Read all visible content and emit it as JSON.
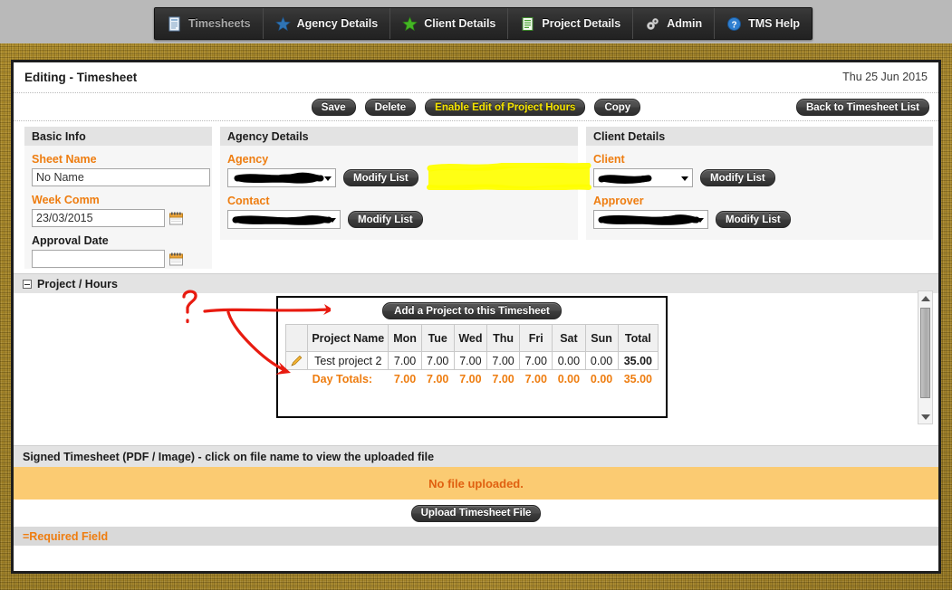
{
  "nav": {
    "items": [
      {
        "label": "Timesheets",
        "icon": "timesheet-document-icon",
        "current": true
      },
      {
        "label": "Agency Details",
        "icon": "blue-star-icon",
        "current": false
      },
      {
        "label": "Client Details",
        "icon": "green-star-icon",
        "current": false
      },
      {
        "label": "Project Details",
        "icon": "green-document-icon",
        "current": false
      },
      {
        "label": "Admin",
        "icon": "gears-icon",
        "current": false
      },
      {
        "label": "TMS Help",
        "icon": "question-circle-icon",
        "current": false
      }
    ]
  },
  "header": {
    "title": "Editing - Timesheet",
    "date": "Thu 25 Jun 2015"
  },
  "toolbar": {
    "save_label": "Save",
    "delete_label": "Delete",
    "enable_edit_label": "Enable Edit of Project Hours",
    "copy_label": "Copy",
    "back_label": "Back to Timesheet List"
  },
  "basic_info": {
    "panel_title": "Basic Info",
    "sheet_name_label": "Sheet Name",
    "sheet_name_value": "No Name",
    "week_comm_label": "Week Comm",
    "week_comm_value": "23/03/2015",
    "approval_date_label": "Approval Date",
    "approval_date_value": ""
  },
  "agency_details": {
    "panel_title": "Agency Details",
    "agency_label": "Agency",
    "agency_value": "",
    "agency_modify_label": "Modify List",
    "contact_label": "Contact",
    "contact_value": "",
    "contact_modify_label": "Modify List"
  },
  "client_details": {
    "panel_title": "Client Details",
    "client_label": "Client",
    "client_value": "",
    "client_modify_label": "Modify List",
    "approver_label": "Approver",
    "approver_value": "",
    "approver_modify_label": "Modify List"
  },
  "project_hours": {
    "section_title": "Project / Hours",
    "add_project_label": "Add a Project to this Timesheet",
    "columns": [
      "",
      "Project Name",
      "Mon",
      "Tue",
      "Wed",
      "Thu",
      "Fri",
      "Sat",
      "Sun",
      "Total"
    ],
    "rows": [
      {
        "edit_icon": "pencil-icon",
        "project_name": "Test project 2",
        "mon": "7.00",
        "tue": "7.00",
        "wed": "7.00",
        "thu": "7.00",
        "fri": "7.00",
        "sat": "0.00",
        "sun": "0.00",
        "total": "35.00"
      }
    ],
    "day_totals": {
      "label": "Day Totals:",
      "mon": "7.00",
      "tue": "7.00",
      "wed": "7.00",
      "thu": "7.00",
      "fri": "7.00",
      "sat": "0.00",
      "sun": "0.00",
      "total": "35.00"
    }
  },
  "signed_timesheet": {
    "section_title": "Signed Timesheet (PDF / Image) - click on file name to view the uploaded file",
    "status": "No file uploaded.",
    "upload_label": "Upload Timesheet File"
  },
  "footer": {
    "required_note": "=Required Field"
  },
  "annotations": {
    "question_mark": "?",
    "highlight_color": "#ffff00",
    "arrow_color": "#e81b10"
  },
  "colors": {
    "required_orange": "#ee7d10",
    "page_background": "#a8852a",
    "nav_background": "#2b2b2b",
    "highlight_yellow": "#ffff00",
    "no_file_bar": "#fbcb72"
  }
}
